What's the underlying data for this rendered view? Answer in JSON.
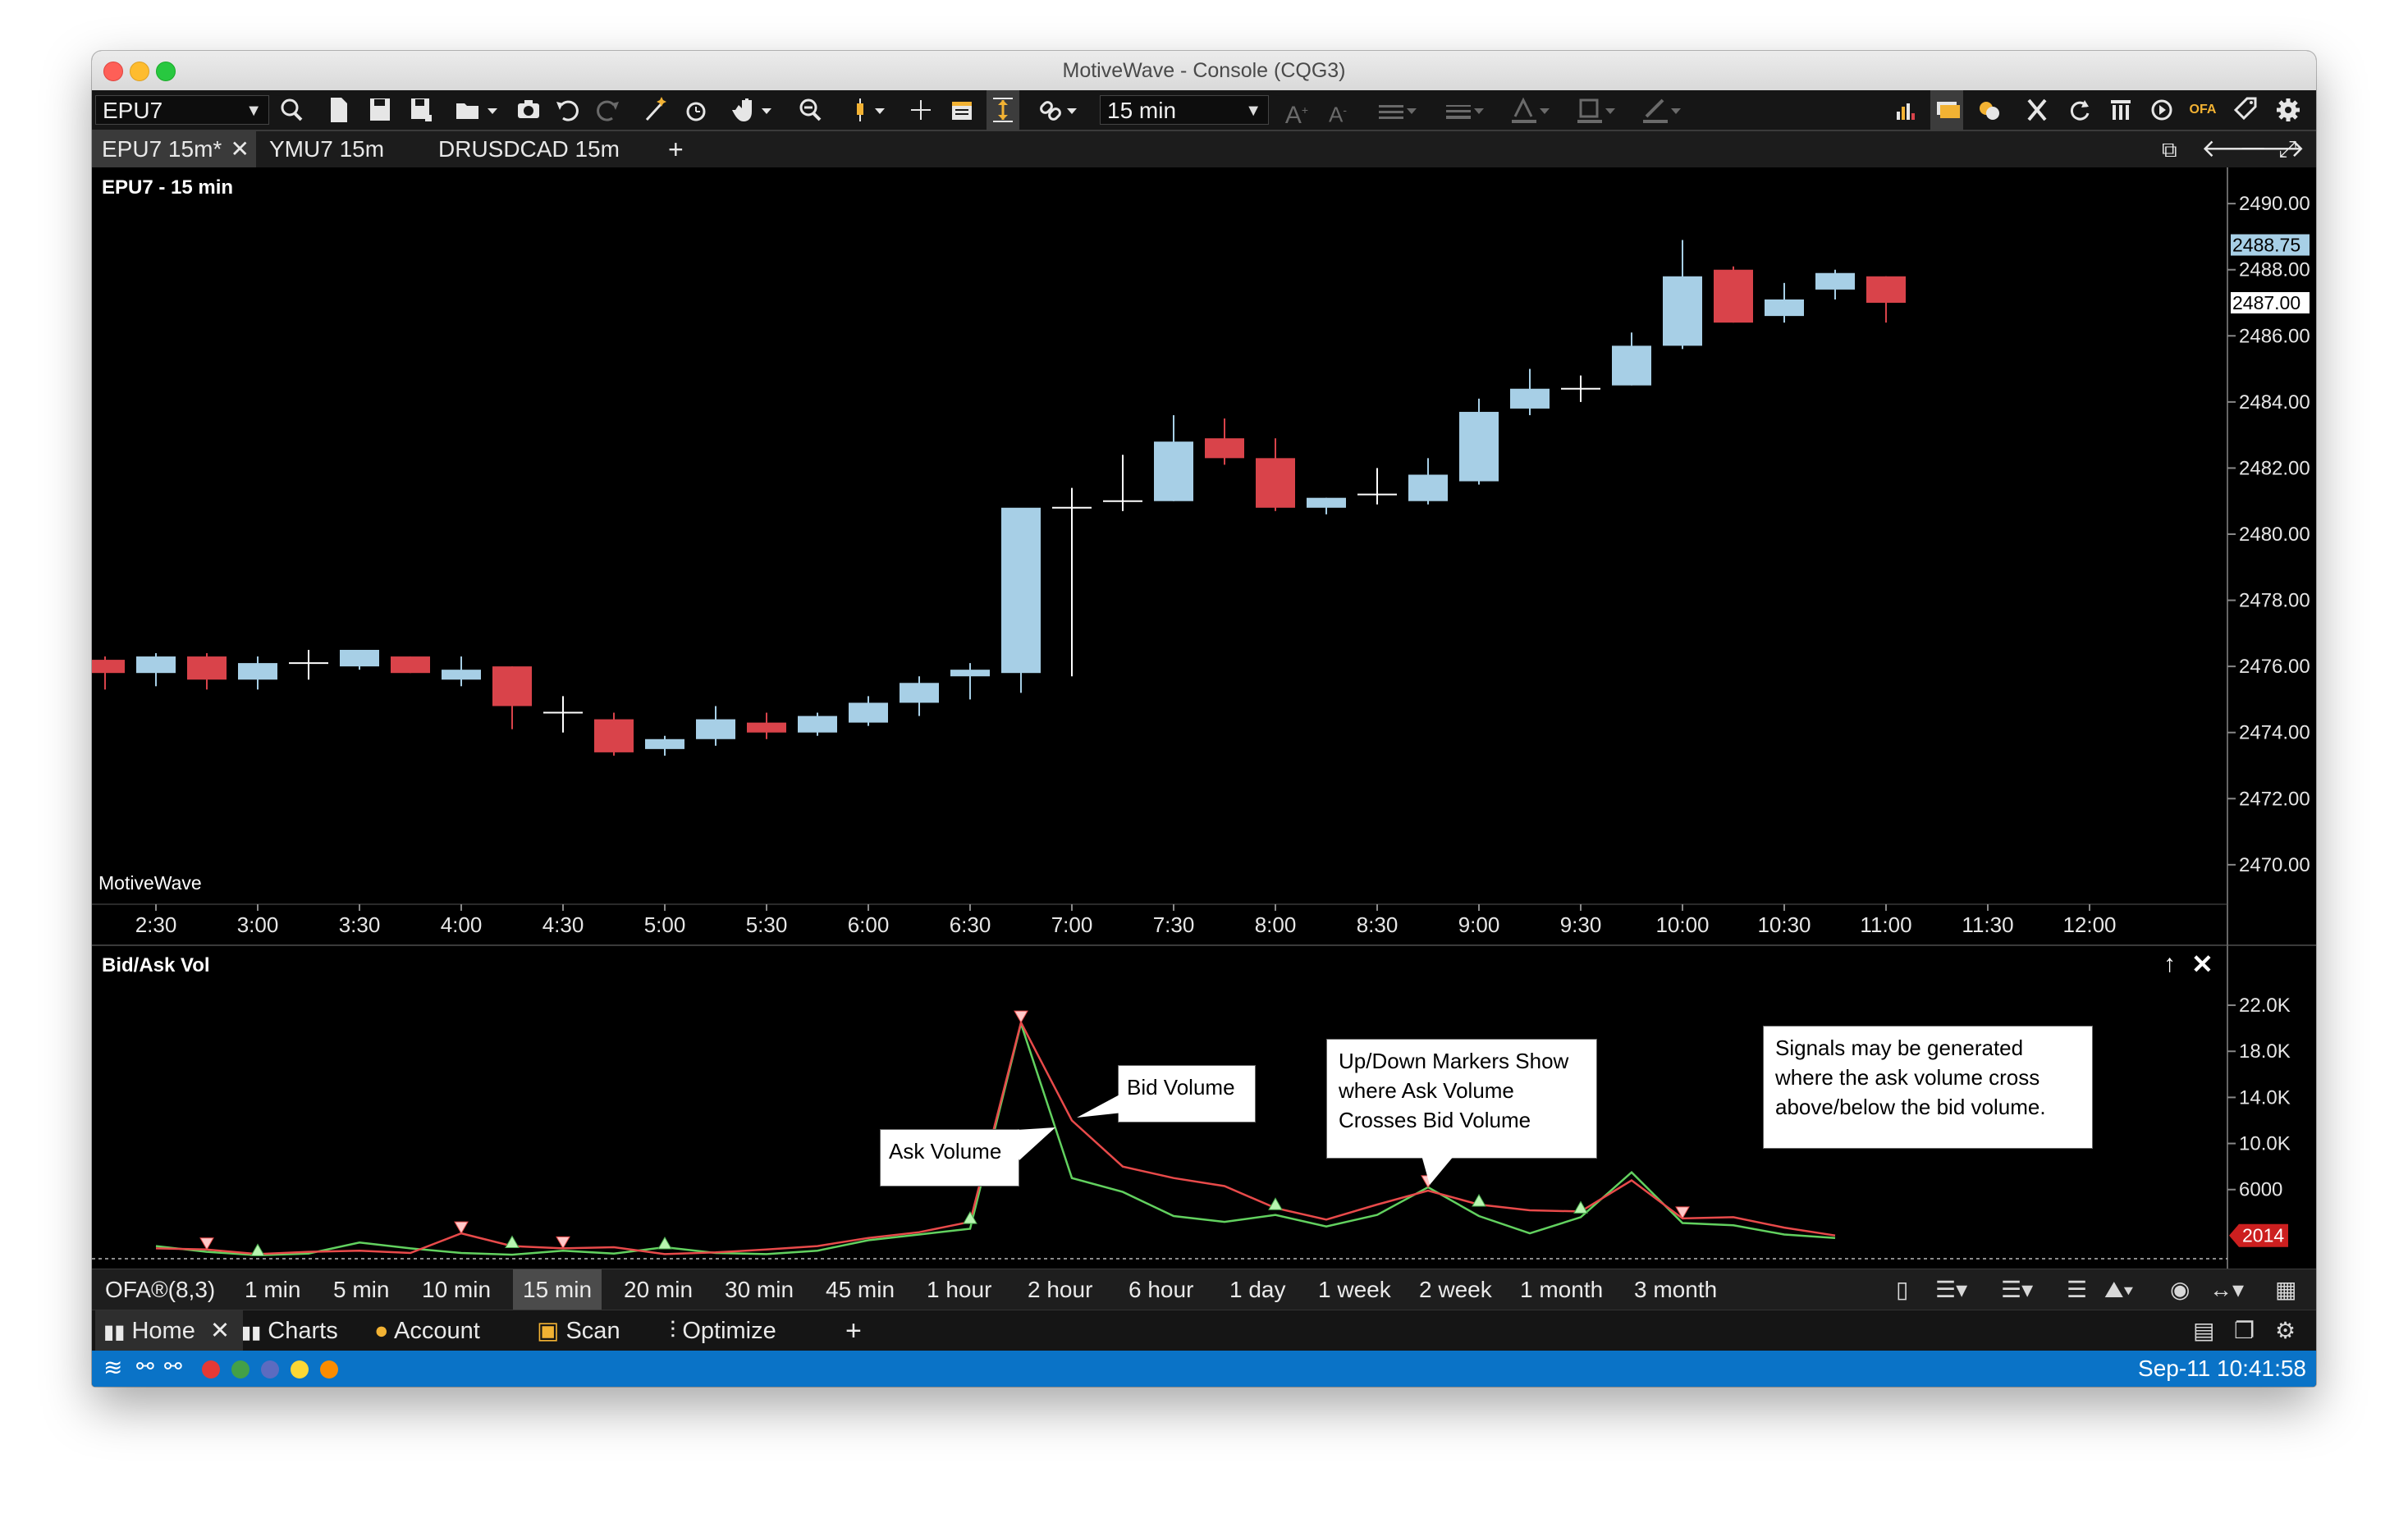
{
  "window": {
    "title": "MotiveWave - Console (CQG3)"
  },
  "toolbar": {
    "symbol": "EPU7",
    "interval": "15 min",
    "icons": [
      "search-icon",
      "new-page-icon",
      "save-icon",
      "save-as-icon",
      "open-folder-icon",
      "camera-icon",
      "undo-icon",
      "redo-icon",
      "magic-wand-icon",
      "alarm-icon",
      "hand-icon",
      "zoom-icon",
      "bar-style-icon",
      "crosshair-icon",
      "data-window-icon",
      "auto-scale-icon",
      "link-icon",
      "font-increase-icon",
      "font-decrease-icon",
      "line-style-icon",
      "line-width-icon",
      "text-color-icon",
      "fill-color-icon",
      "draw-color-icon",
      "dom-icon",
      "chat-icon",
      "news-icon",
      "tools-icon",
      "refresh-icon",
      "columns-icon",
      "replay-icon",
      "ofa-icon",
      "tag-icon",
      "gear-icon"
    ],
    "ofa_label": "OFA"
  },
  "chart_tabs": [
    {
      "label": "EPU7 15m*",
      "active": true
    },
    {
      "label": "YMU7 15m",
      "active": false
    },
    {
      "label": "DRUSDCAD 15m",
      "active": false
    }
  ],
  "price_chart": {
    "title": "EPU7 - 15 min",
    "watermark": "MotiveWave",
    "last_price_label": "2488.75",
    "current_price_label": "2487.00"
  },
  "indicator_panel": {
    "title": "Bid/Ask Vol",
    "last_value_label": "2014"
  },
  "annotations": {
    "ask_volume": "Ask Volume",
    "bid_volume": "Bid Volume",
    "markers_note": [
      "Up/Down Markers Show",
      "where Ask Volume",
      "Crosses Bid Volume"
    ],
    "signals_note": [
      "Signals may be generated",
      "where the ask volume cross",
      "above/below the bid volume."
    ]
  },
  "bar_size_bar": {
    "indicator_label": "OFA®(8,3)",
    "items": [
      "1 min",
      "5 min",
      "10 min",
      "15 min",
      "20 min",
      "30 min",
      "45 min",
      "1 hour",
      "2 hour",
      "6 hour",
      "1 day",
      "1 week",
      "2 week",
      "1 month",
      "3 month"
    ],
    "selected": "15 min"
  },
  "nav_tabs": [
    {
      "label": "Home",
      "icon": "bar-chart-icon",
      "active": true
    },
    {
      "label": "Charts",
      "icon": "chart-icon",
      "active": false
    },
    {
      "label": "Account",
      "icon": "user-icon",
      "active": false
    },
    {
      "label": "Scan",
      "icon": "scan-icon",
      "active": false
    },
    {
      "label": "Optimize",
      "icon": "sliders-icon",
      "active": false
    }
  ],
  "status_bar": {
    "datetime": "Sep-11 10:41:58",
    "dot_colors": [
      "#e53935",
      "#43a047",
      "#5c6bc0",
      "#fdd835",
      "#fb8c00"
    ]
  },
  "colors": {
    "up_candle": "#a7cfe6",
    "down_candle": "#d9434a",
    "ask_line": "#62d15f",
    "bid_line": "#e84a4a",
    "status_bar": "#0a73c7",
    "price_tag_red": "#cc1f1f"
  },
  "chart_data": [
    {
      "type": "candlestick",
      "title": "EPU7 - 15 min",
      "x_ticks": [
        "2:30",
        "3:00",
        "3:30",
        "4:00",
        "4:30",
        "5:00",
        "5:30",
        "6:00",
        "6:30",
        "7:00",
        "7:30",
        "8:00",
        "8:30",
        "9:00",
        "9:30",
        "10:00",
        "10:30",
        "11:00",
        "11:30",
        "12:00"
      ],
      "y_ticks": [
        "2490.00",
        "2488.00",
        "2486.00",
        "2484.00",
        "2482.00",
        "2480.00",
        "2478.00",
        "2476.00",
        "2474.00",
        "2472.00",
        "2470.00"
      ],
      "ylim": [
        2469.5,
        2490.5
      ],
      "bars_start_time": "2:15",
      "interval_minutes": 15,
      "ohlc": [
        [
          2476.2,
          2476.3,
          2475.3,
          2475.8
        ],
        [
          2475.8,
          2476.4,
          2475.4,
          2476.3
        ],
        [
          2476.3,
          2476.4,
          2475.3,
          2475.6
        ],
        [
          2475.6,
          2476.3,
          2475.3,
          2476.1
        ],
        [
          2476.1,
          2476.5,
          2475.6,
          2476.1
        ],
        [
          2476.0,
          2476.5,
          2475.9,
          2476.5
        ],
        [
          2476.3,
          2476.3,
          2475.8,
          2475.8
        ],
        [
          2475.6,
          2476.3,
          2475.4,
          2475.9
        ],
        [
          2476.0,
          2476.0,
          2474.1,
          2474.8
        ],
        [
          2474.6,
          2475.1,
          2474.0,
          2474.6
        ],
        [
          2474.4,
          2474.6,
          2473.3,
          2473.4
        ],
        [
          2473.5,
          2473.9,
          2473.3,
          2473.8
        ],
        [
          2473.8,
          2474.8,
          2473.6,
          2474.4
        ],
        [
          2474.3,
          2474.6,
          2473.8,
          2474.0
        ],
        [
          2474.0,
          2474.6,
          2473.9,
          2474.5
        ],
        [
          2474.3,
          2475.1,
          2474.2,
          2474.9
        ],
        [
          2474.9,
          2475.7,
          2474.5,
          2475.5
        ],
        [
          2475.7,
          2476.1,
          2475.0,
          2475.9
        ],
        [
          2475.8,
          2476.2,
          2475.2,
          2480.8
        ],
        [
          2480.8,
          2481.4,
          2475.7,
          2480.8
        ],
        [
          2481.0,
          2482.4,
          2480.7,
          2481.0
        ],
        [
          2481.0,
          2483.6,
          2481.0,
          2482.8
        ],
        [
          2482.9,
          2483.5,
          2482.1,
          2482.3
        ],
        [
          2482.3,
          2482.9,
          2480.7,
          2480.8
        ],
        [
          2480.8,
          2481.1,
          2480.6,
          2481.1
        ],
        [
          2481.2,
          2482.0,
          2480.9,
          2481.2
        ],
        [
          2481.0,
          2482.3,
          2480.9,
          2481.8
        ],
        [
          2481.6,
          2484.1,
          2481.5,
          2483.7
        ],
        [
          2483.8,
          2485.0,
          2483.6,
          2484.4
        ],
        [
          2484.4,
          2484.8,
          2484.0,
          2484.4
        ],
        [
          2484.5,
          2486.1,
          2484.5,
          2485.7
        ],
        [
          2485.7,
          2488.9,
          2485.6,
          2487.8
        ],
        [
          2488.0,
          2488.1,
          2486.4,
          2486.4
        ],
        [
          2486.6,
          2487.6,
          2486.4,
          2487.1
        ],
        [
          2487.4,
          2488.0,
          2487.1,
          2487.9
        ],
        [
          2487.8,
          2487.8,
          2486.4,
          2487.0
        ]
      ]
    },
    {
      "type": "line",
      "title": "Bid/Ask Vol",
      "y_ticks": [
        "22.0K",
        "18.0K",
        "14.0K",
        "10.0K",
        "6000"
      ],
      "ylim": [
        0,
        23500
      ],
      "series": [
        {
          "name": "Ask Volume",
          "values": [
            1100,
            600,
            300,
            450,
            1400,
            900,
            500,
            350,
            700,
            450,
            1000,
            500,
            400,
            700,
            1600,
            2100,
            2600,
            20400,
            7000,
            5800,
            3700,
            3200,
            3800,
            2800,
            3800,
            6200,
            3700,
            2200,
            3600,
            7500,
            3100,
            2900,
            2100,
            1800
          ]
        },
        {
          "name": "Bid Volume",
          "values": [
            900,
            800,
            400,
            600,
            700,
            500,
            2200,
            1100,
            900,
            1000,
            400,
            550,
            800,
            1100,
            1800,
            2300,
            3200,
            20500,
            12000,
            8000,
            7000,
            6300,
            4400,
            3400,
            4700,
            5900,
            4700,
            4200,
            4100,
            6800,
            3500,
            3600,
            2700,
            2014
          ]
        }
      ],
      "up_markers_at_index": [
        2,
        7,
        10,
        16,
        22,
        26,
        28
      ],
      "down_markers_at_index": [
        1,
        6,
        8,
        17,
        25,
        30
      ],
      "last_value": 2014
    }
  ]
}
